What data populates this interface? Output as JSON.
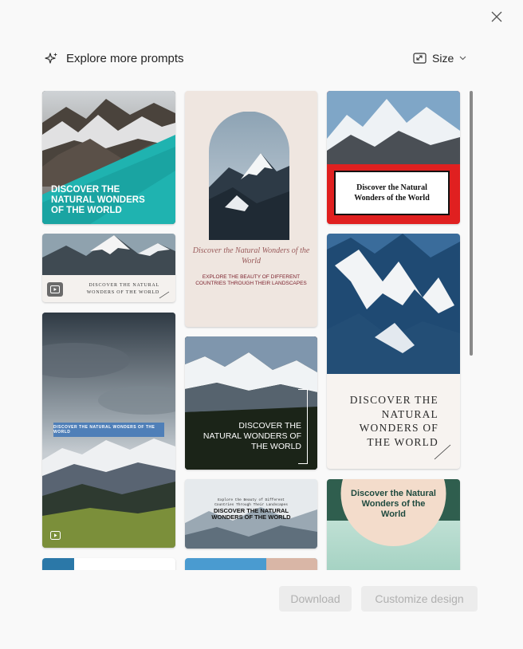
{
  "header": {
    "title": "Explore more prompts",
    "size_label": "Size"
  },
  "cards": {
    "c1": {
      "title": "DISCOVER THE NATURAL WONDERS OF THE WORLD"
    },
    "c2": {
      "title": "DISCOVER THE NATURAL WONDERS OF THE WORLD"
    },
    "c3": {
      "title": "DISCOVER THE NATURAL WONDERS OF THE WORLD"
    },
    "c4": {
      "script_title": "Discover the Natural Wonders of the World",
      "subtitle": "EXPLORE THE BEAUTY OF DIFFERENT COUNTRIES THROUGH THEIR LANDSCAPES"
    },
    "c5": {
      "title": "DISCOVER THE NATURAL WONDERS OF THE WORLD"
    },
    "c6": {
      "kicker": "Explore the Beauty of Different Countries Through Their Landscapes",
      "title": "DISCOVER THE NATURAL WONDERS OF THE WORLD"
    },
    "c7": {
      "title": "Discover the Natural Wonders of the World"
    },
    "c8": {
      "title": "DISCOVER THE NATURAL WONDERS OF THE WORLD"
    },
    "c9": {
      "title": "Discover the Natural Wonders of the World"
    }
  },
  "footer": {
    "download_label": "Download",
    "customize_label": "Customize design"
  },
  "colors": {
    "teal": "#1fb3b0",
    "red": "#e02020",
    "burgundy": "#7a1e2a",
    "dark_green": "#2f5e4e",
    "peach": "#f3dccb",
    "blue_banner": "#4f7fb8"
  }
}
